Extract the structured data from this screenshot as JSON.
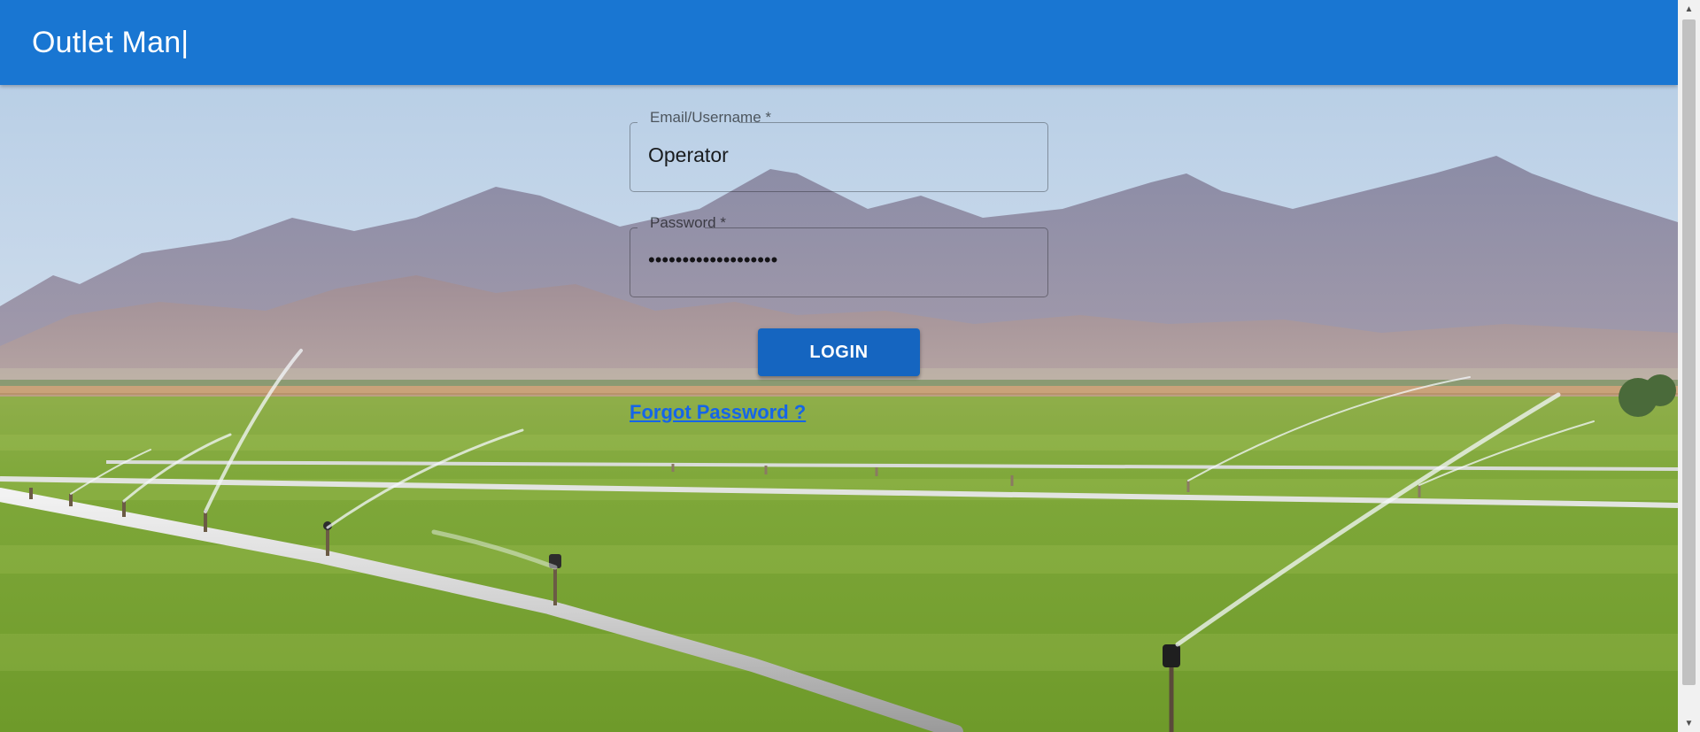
{
  "app": {
    "title": "Outlet Man|",
    "accent_color": "#1976d2"
  },
  "login_form": {
    "email_label": "Email/Username *",
    "email_value": "Operator",
    "password_label": "Password *",
    "password_value": "•••••••••••••••••••",
    "login_button": "LOGIN",
    "forgot_link": "Forgot Password ?"
  },
  "background": {
    "description_icon": "irrigation-field-image"
  },
  "scrollbar": {
    "up_icon": "chevron-up-icon",
    "down_icon": "chevron-down-icon"
  }
}
